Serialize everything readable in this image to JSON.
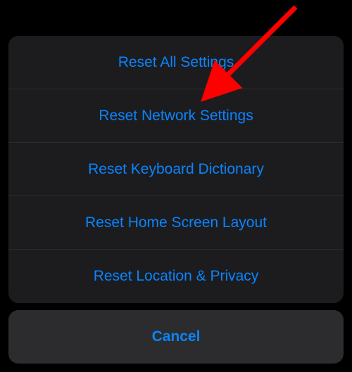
{
  "actionSheet": {
    "items": [
      {
        "label": "Reset All Settings"
      },
      {
        "label": "Reset Network Settings"
      },
      {
        "label": "Reset Keyboard Dictionary"
      },
      {
        "label": "Reset Home Screen Layout"
      },
      {
        "label": "Reset Location & Privacy"
      }
    ],
    "cancel_label": "Cancel"
  },
  "colors": {
    "accent": "#0a84ff",
    "sheet_bg": "#1c1c1e",
    "cancel_bg": "#2c2c2e",
    "divider": "#2c2c2e",
    "page_bg": "#000000",
    "arrow": "#ff0000"
  },
  "annotation": {
    "target_index": 1,
    "description": "red-arrow-pointing-to-reset-network-settings"
  }
}
